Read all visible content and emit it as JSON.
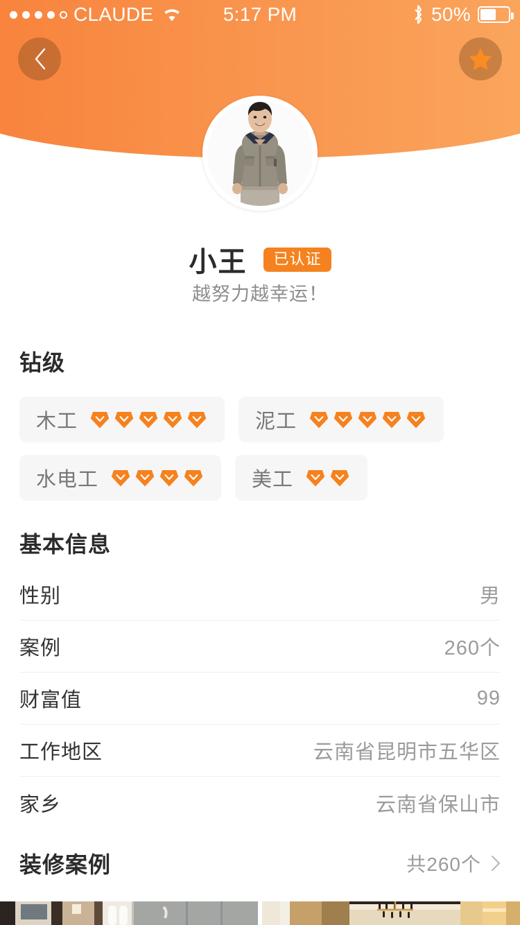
{
  "status_bar": {
    "carrier": "CLAUDE",
    "signal_dots_filled": 4,
    "signal_dots_total": 5,
    "wifi_icon": "wifi-icon",
    "time": "5:17 PM",
    "bluetooth_icon": "bluetooth-icon",
    "battery_percent": "50%",
    "battery_level": 50
  },
  "header": {
    "back_icon": "chevron-left-icon",
    "favorite_icon": "star-icon",
    "gradient_from": "#f8813a",
    "gradient_to": "#faa75f",
    "avatar_icon": "user-avatar-photo"
  },
  "profile": {
    "name": "小王",
    "verified_badge": "已认证",
    "verified_color": "#f5821f",
    "tagline": "越努力越幸运！"
  },
  "diamond_section": {
    "title": "钻级",
    "gem_color": "#f5821f",
    "skills": [
      {
        "label": "木工",
        "level": 5
      },
      {
        "label": "泥工",
        "level": 5
      },
      {
        "label": "水电工",
        "level": 4
      },
      {
        "label": "美工",
        "level": 2
      }
    ]
  },
  "basic_info": {
    "title": "基本信息",
    "rows": [
      {
        "label": "性别",
        "value": "男"
      },
      {
        "label": "案例",
        "value": "260个"
      },
      {
        "label": "财富值",
        "value": "99"
      },
      {
        "label": "工作地区",
        "value": "云南省昆明市五华区"
      },
      {
        "label": "家乡",
        "value": "云南省保山市"
      }
    ]
  },
  "cases_section": {
    "title": "装修案例",
    "count_label": "共260个",
    "chevron_icon": "chevron-right-icon",
    "thumbnails": [
      {
        "name": "bathroom-gray-tile-thumbnail"
      },
      {
        "name": "living-room-chandelier-thumbnail"
      }
    ]
  }
}
